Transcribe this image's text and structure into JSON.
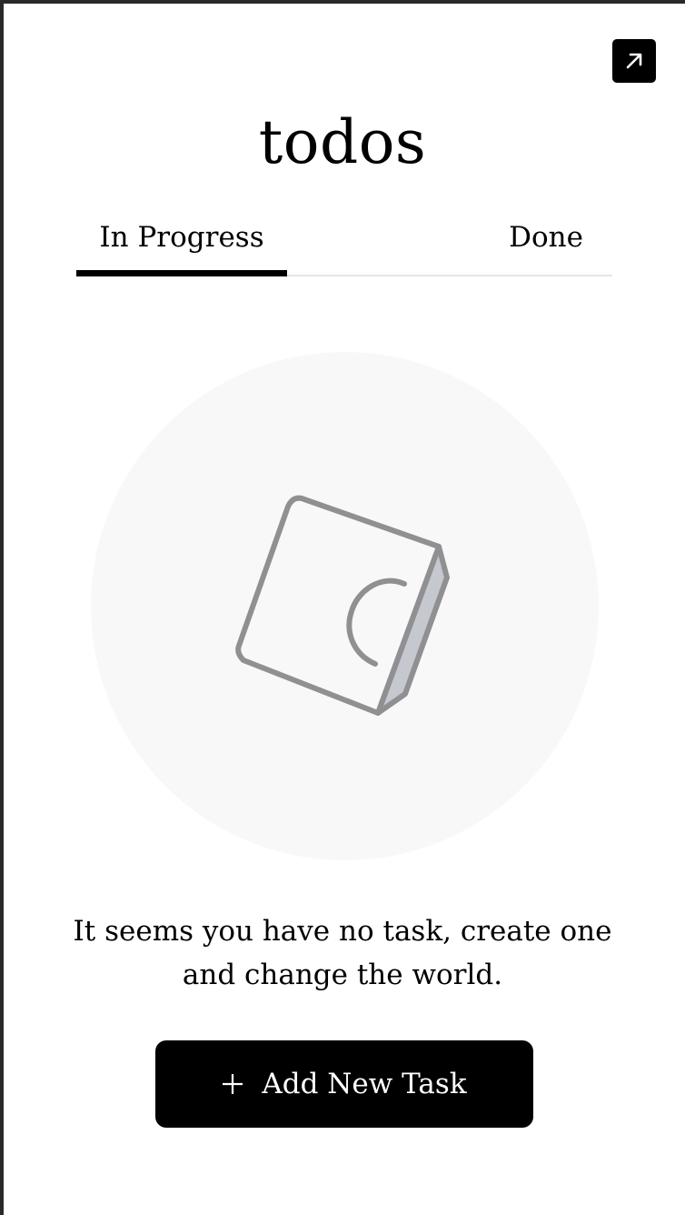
{
  "app": {
    "title": "todos"
  },
  "toolbar": {
    "expand_icon": "arrow-up-right-icon"
  },
  "tabs": [
    {
      "label": "In Progress",
      "active": true
    },
    {
      "label": "Done",
      "active": false
    }
  ],
  "empty_state": {
    "illustration_icon": "notebook-icon",
    "message": "It seems you have no task, create one and change the world.",
    "button_label": "Add New Task",
    "button_icon": "plus-icon"
  },
  "colors": {
    "accent": "#000000",
    "illustration_circle": "#f8f8f8",
    "illustration_stroke": "#909093",
    "illustration_spine": "#c5c8cf"
  }
}
